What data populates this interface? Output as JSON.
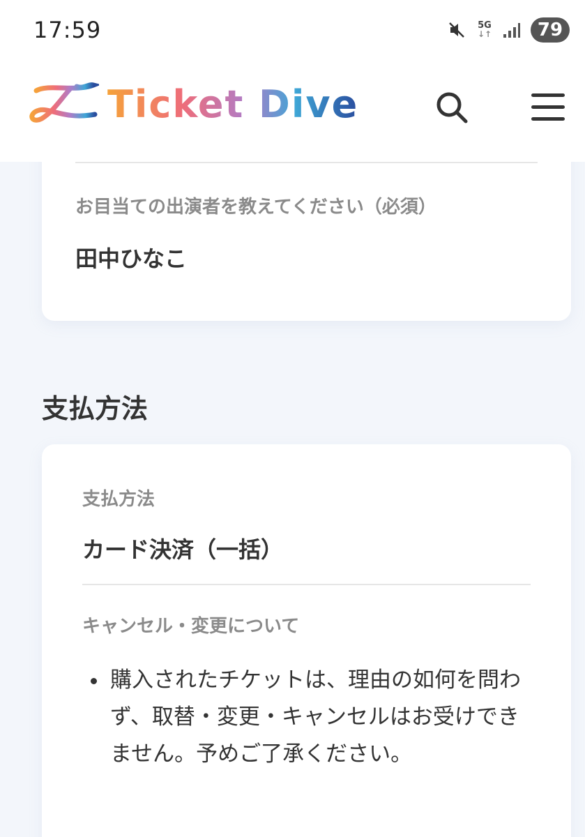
{
  "status_bar": {
    "time": "17:59",
    "network": "5G",
    "battery": "79",
    "icons": [
      "mute-icon",
      "signal-icon",
      "battery-icon"
    ]
  },
  "header": {
    "logo_text": "Ticket Dive",
    "icons": [
      "search-icon",
      "menu-icon"
    ]
  },
  "performer": {
    "label": "お目当ての出演者を教えてください（必須）",
    "value": "田中ひなこ"
  },
  "payment": {
    "section_title": "支払方法",
    "method_label": "支払方法",
    "method_value": "カード決済（一括）",
    "cancel_label": "キャンセル・変更について",
    "cancel_items": [
      "購入されたチケットは、理由の如何を問わず、取替・変更・キャンセルはお受けできません。予めご了承ください。"
    ]
  },
  "colors": {
    "background": "#f3f6fb",
    "card": "#ffffff",
    "label": "#8a8a8a",
    "text": "#333333"
  }
}
